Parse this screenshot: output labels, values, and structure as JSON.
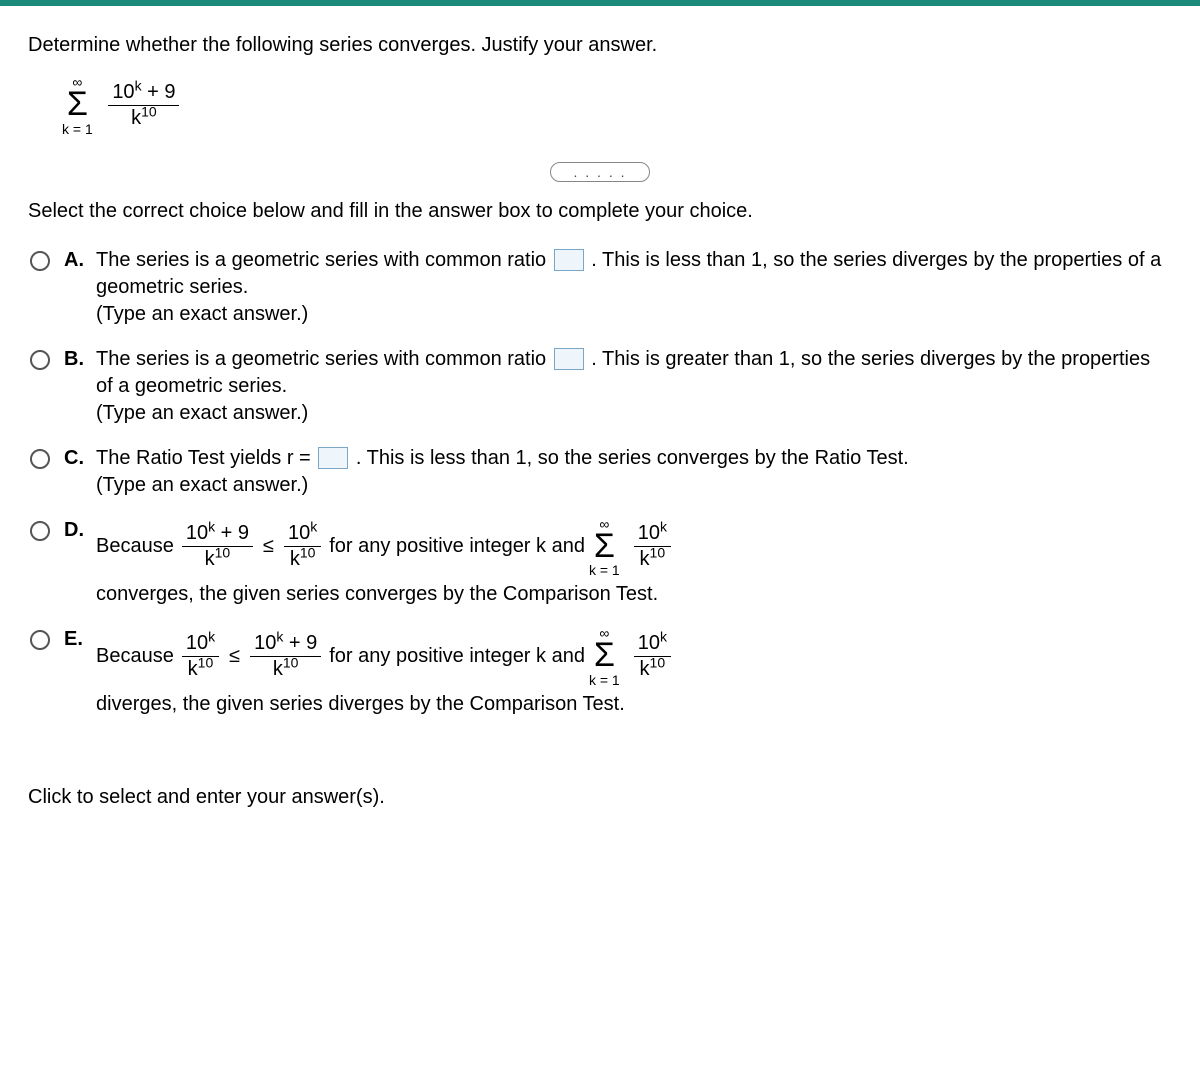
{
  "question": "Determine whether the following series converges. Justify your answer.",
  "series": {
    "sum_top": "∞",
    "sum_bottom": "k = 1",
    "frac_num_base": "10",
    "frac_num_exp": "k",
    "frac_num_plus": " + 9",
    "frac_den_base": "k",
    "frac_den_exp": "10"
  },
  "separator_dots": ". . . . .",
  "instruction": "Select the correct choice below and fill in the answer box to complete your choice.",
  "choices": {
    "A": {
      "label": "A.",
      "part1": "The series is a geometric series with common ratio ",
      "part2": ". This is less than 1, so the series diverges by the properties of a geometric series.",
      "hint": "(Type an exact answer.)"
    },
    "B": {
      "label": "B.",
      "part1": "The series is a geometric series with common ratio ",
      "part2": ". This is greater than 1, so the series diverges by the properties of a geometric series.",
      "hint": "(Type an exact answer.)"
    },
    "C": {
      "label": "C.",
      "part1": "The Ratio Test yields r = ",
      "part2": ". This is less than 1, so the series converges by the Ratio Test.",
      "hint": "(Type an exact answer.)"
    },
    "D": {
      "label": "D.",
      "lead": "Because ",
      "mid1": " for any positive integer k and ",
      "mid2": " converges, the given series converges by the Comparison Test."
    },
    "E": {
      "label": "E.",
      "lead": "Because ",
      "mid1": " for any positive integer k and ",
      "mid2": " diverges, the given series diverges by the Comparison Test."
    }
  },
  "math": {
    "le": "≤",
    "ten": "10",
    "k": "k",
    "plus9": " + 9",
    "inf": "∞",
    "k_eq_1": "k = 1"
  },
  "footer": "Click to select and enter your answer(s)."
}
